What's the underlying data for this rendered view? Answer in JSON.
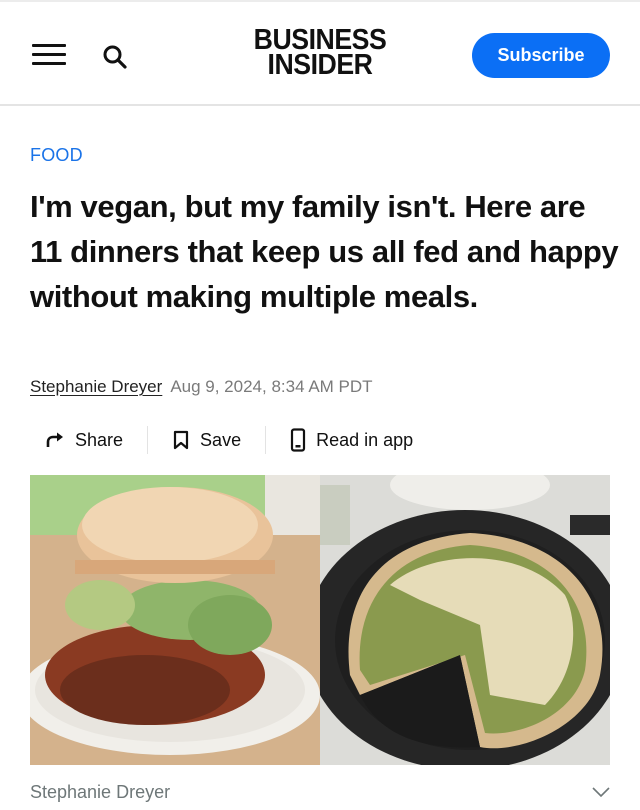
{
  "header": {
    "menu_icon": "hamburger-menu-icon",
    "search_icon": "search-icon",
    "logo_line1": "BUSINESS",
    "logo_line2": "INSIDER",
    "subscribe_label": "Subscribe",
    "accent_color": "#0b6ff5"
  },
  "article": {
    "category": "FOOD",
    "headline": "I'm vegan, but my family isn't. Here are 11 dinners that keep us all fed and happy without making multiple meals.",
    "author": "Stephanie Dreyer",
    "timestamp": "Aug 9, 2024, 8:34 AM PDT"
  },
  "actions": [
    {
      "label": "Share",
      "icon": "share-arrow-icon"
    },
    {
      "label": "Save",
      "icon": "bookmark-icon"
    },
    {
      "label": "Read in app",
      "icon": "phone-icon"
    }
  ],
  "hero_image": {
    "left_alt": "Lentil sloppy joe on a bun with avocado and lettuce",
    "right_alt": "Spinach pesto deep-dish pizza in a cast iron skillet with a slice removed",
    "caption_credit": "Stephanie Dreyer",
    "expand_icon": "chevron-down-icon"
  }
}
